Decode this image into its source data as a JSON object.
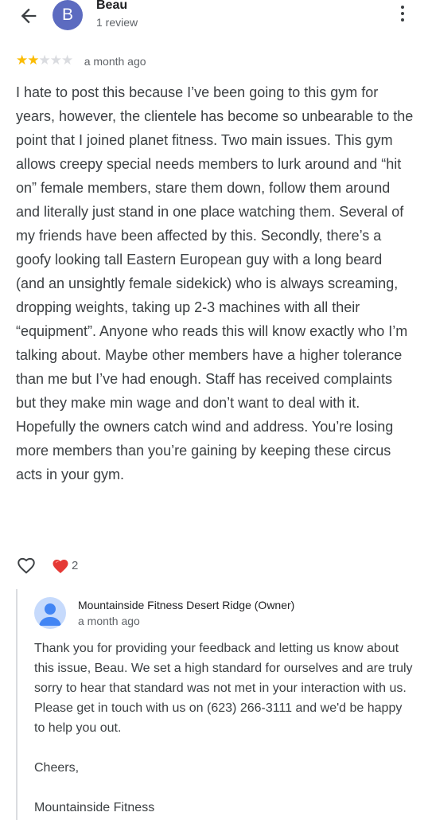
{
  "reviewer": {
    "initial": "B",
    "name": "Beau",
    "review_count": "1 review"
  },
  "icons": {
    "back": "back-arrow-icon",
    "more": "more-vert-icon",
    "like": "heart-outline-icon",
    "reaction": "red-heart-icon",
    "owner_avatar": "person-avatar-icon"
  },
  "rating": {
    "stars": 2,
    "out_of": 5,
    "date": "a month ago"
  },
  "review": {
    "text": "I hate to post this because I’ve been going to this gym for years, however, the clientele has become so unbearable to the point that I joined planet fitness. Two main issues. This gym allows creepy special needs members to lurk around and “hit on” female members, stare them down, follow them around and literally just stand in one place watching them. Several of my friends have been affected by this. Secondly, there’s a goofy looking tall Eastern European guy with a long beard (and an unsightly female sidekick) who is always screaming, dropping weights, taking up 2-3 machines with all their “equipment”. Anyone who reads this will know exactly who I’m talking about. Maybe other members have a higher tolerance than me but I’ve had enough. Staff has received complaints but they make min wage and don’t want to deal with it. Hopefully the owners catch wind and address. You’re losing more members than you’re gaining by keeping these circus acts in your gym."
  },
  "reactions": {
    "count": "2"
  },
  "owner_response": {
    "name": "Mountainside Fitness Desert Ridge (Owner)",
    "date": "a month ago",
    "text": "Thank you for providing your feedback and letting us know about this issue, Beau. We set a high standard for ourselves and are truly sorry to hear that standard was not met in your interaction with us. Please get in touch with us on (623) 266-3111 and we'd be happy to help you out.\n\nCheers,\n\nMountainside Fitness"
  },
  "colors": {
    "avatar_bg": "#5c6bc0",
    "star_filled": "#fbbc04",
    "star_empty": "#dadce0",
    "heart_red": "#e53935"
  }
}
